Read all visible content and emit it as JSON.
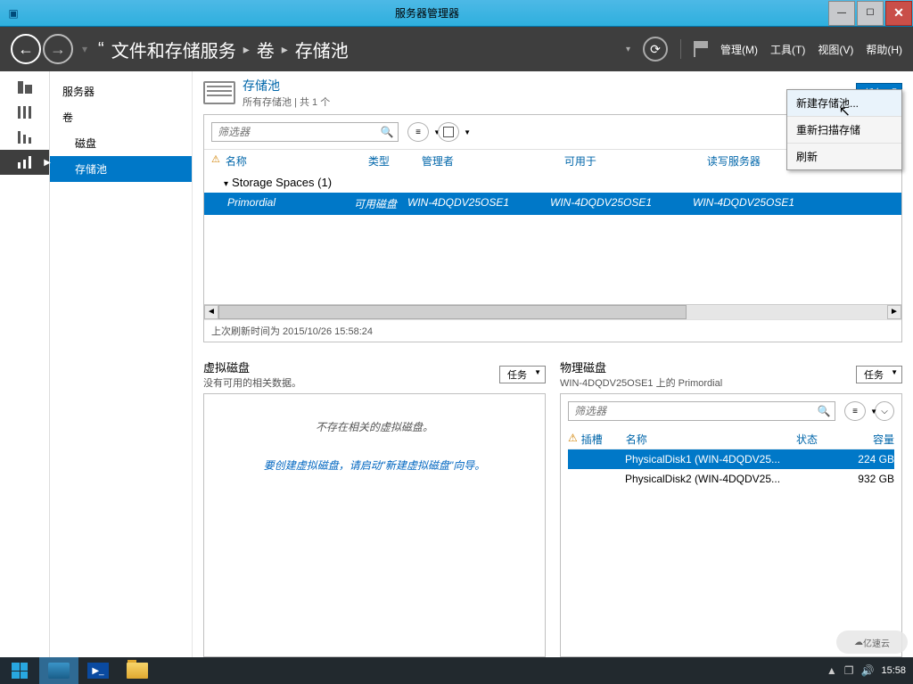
{
  "window": {
    "title": "服务器管理器"
  },
  "header": {
    "breadcrumb": {
      "prefix": "“",
      "svc": "文件和存储服务",
      "vol": "卷",
      "pool": "存储池"
    },
    "menus": {
      "manage": "管理(M)",
      "tools": "工具(T)",
      "view": "视图(V)",
      "help": "帮助(H)"
    }
  },
  "sidebar": {
    "items": [
      "服务器",
      "卷",
      "磁盘",
      "存储池"
    ]
  },
  "pool": {
    "title": "存储池",
    "subtitle": "所有存储池 | 共 1 个",
    "tasks_label": "任务",
    "filter_placeholder": "筛选器",
    "columns": {
      "name": "名称",
      "type": "类型",
      "manager": "管理者",
      "usable": "可用于",
      "rw": "读写服务器"
    },
    "group": "Storage Spaces (1)",
    "row": {
      "name": "Primordial",
      "type": "可用磁盘",
      "manager": "WIN-4DQDV25OSE1",
      "usable": "WIN-4DQDV25OSE1",
      "rw": "WIN-4DQDV25OSE1"
    },
    "last_refresh": "上次刷新时间为 2015/10/26 15:58:24"
  },
  "tasks_menu": {
    "new_pool": "新建存储池...",
    "rescan": "重新扫描存储",
    "refresh": "刷新"
  },
  "virtual_disks": {
    "title": "虚拟磁盘",
    "subtitle": "没有可用的相关数据。",
    "tasks_label": "任务",
    "empty1": "不存在相关的虚拟磁盘。",
    "empty2": "要创建虚拟磁盘，请启动\"新建虚拟磁盘\"向导。"
  },
  "physical_disks": {
    "title": "物理磁盘",
    "subtitle": "WIN-4DQDV25OSE1 上的 Primordial",
    "tasks_label": "任务",
    "filter_placeholder": "筛选器",
    "columns": {
      "slot": "插槽",
      "name": "名称",
      "status": "状态",
      "capacity": "容量"
    },
    "rows": [
      {
        "name": "PhysicalDisk1 (WIN-4DQDV25...",
        "capacity": "224 GB"
      },
      {
        "name": "PhysicalDisk2 (WIN-4DQDV25...",
        "capacity": "932 GB"
      }
    ]
  },
  "taskbar": {
    "clock": "15:58"
  },
  "watermark": "亿速云"
}
